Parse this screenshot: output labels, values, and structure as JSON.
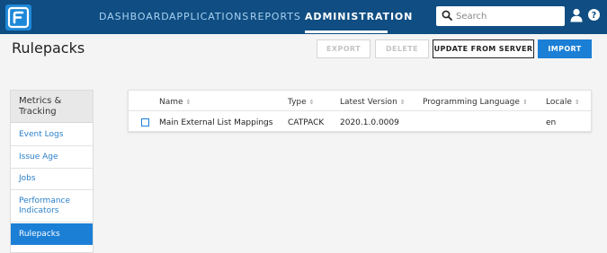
{
  "nav": {
    "items": [
      "DASHBOARD",
      "APPLICATIONS",
      "REPORTS",
      "ADMINISTRATION"
    ],
    "active": "ADMINISTRATION"
  },
  "search": {
    "placeholder": "Search"
  },
  "page": {
    "title": "Rulepacks",
    "buttons": {
      "export": "EXPORT",
      "delete": "DELETE",
      "update": "UPDATE FROM SERVER",
      "import": "IMPORT"
    }
  },
  "sidebar": {
    "header": "Metrics & Tracking",
    "items": [
      "Event Logs",
      "Issue Age",
      "Jobs",
      "Performance Indicators",
      "Rulepacks"
    ],
    "active": "Rulepacks"
  },
  "table": {
    "columns": [
      "Name",
      "Type",
      "Latest Version",
      "Programming Language",
      "Locale"
    ],
    "rows": [
      {
        "name": "Main External List Mappings",
        "type": "CATPACK",
        "version": "2020.1.0.0009",
        "language": "",
        "locale": "en"
      }
    ]
  },
  "icons": {
    "logo": "fortify-logo-icon",
    "search": "search-icon",
    "user": "user-icon",
    "help": "help-icon",
    "sort": "sort-icon"
  },
  "colors": {
    "topbar": "#0f4d82",
    "accent": "#1b7fd6",
    "link": "#2a7fc9",
    "nav_inactive": "#a9d2f2"
  }
}
